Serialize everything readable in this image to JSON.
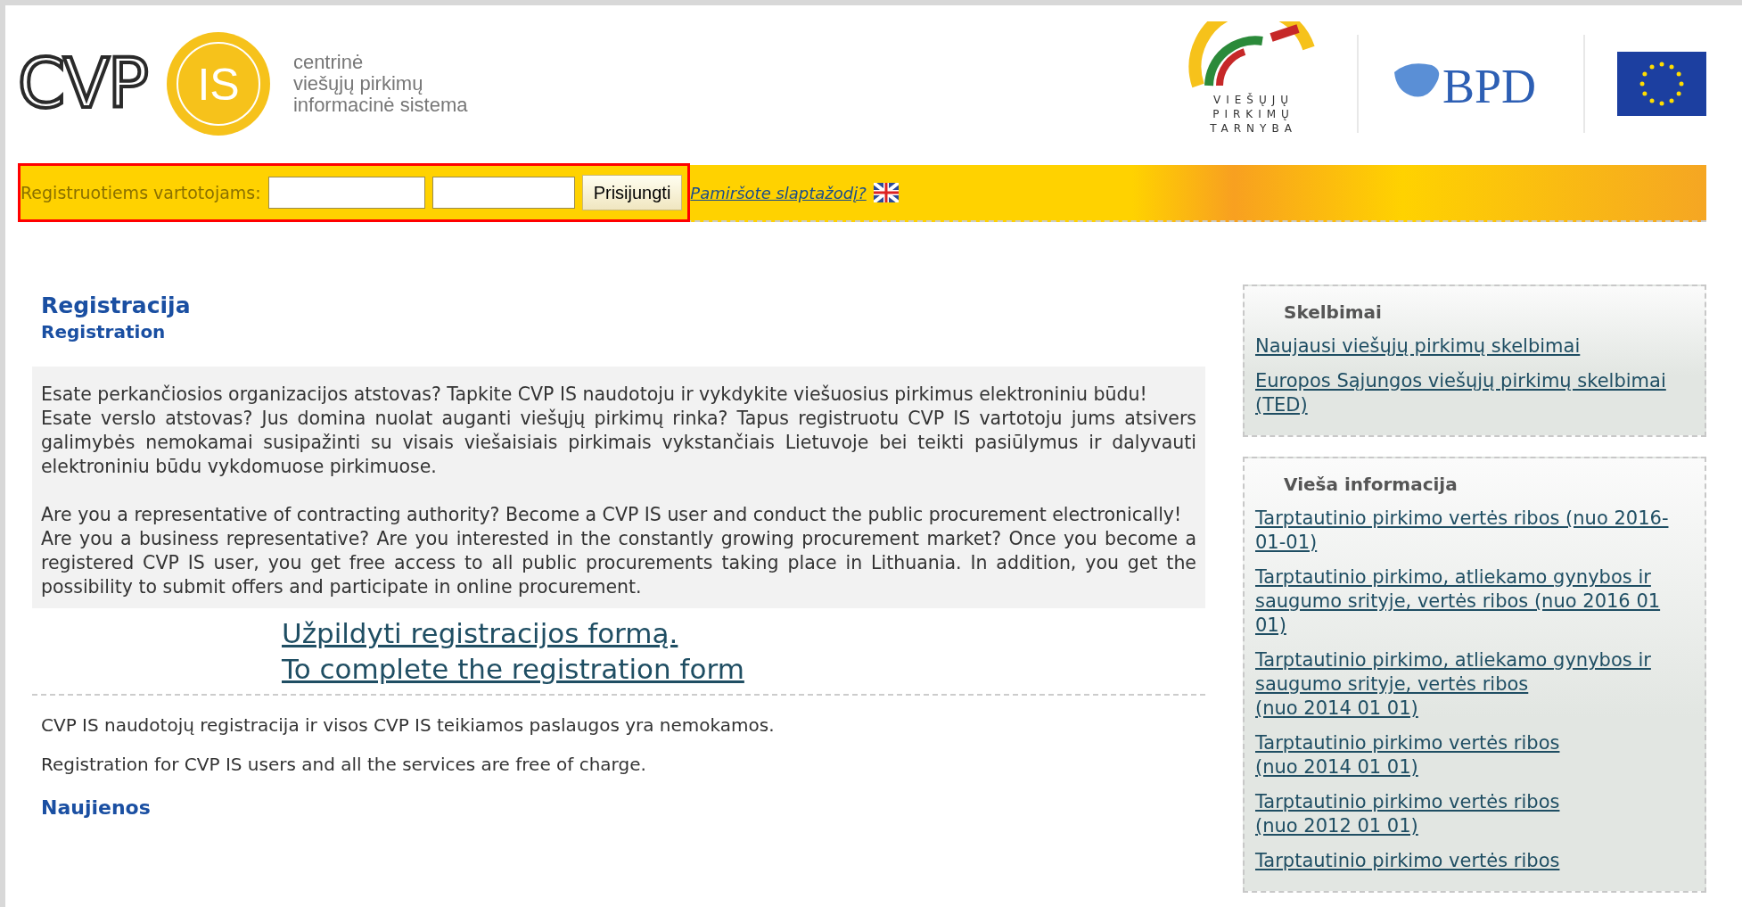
{
  "header": {
    "logo_letters": "CVP",
    "logo_badge": "IS",
    "tagline": [
      "centrinė",
      "viešųjų pirkimų",
      "informacinė sistema"
    ],
    "partner_logos": [
      {
        "kind": "vpt",
        "lines": [
          "VIEŠŲJŲ",
          "PIRKIMŲ",
          "TARNYBA"
        ]
      },
      {
        "kind": "bpd",
        "text": "BPD"
      },
      {
        "kind": "eu"
      }
    ]
  },
  "login": {
    "highlighted": true,
    "label": "Registruotiems vartotojams:",
    "fields": [
      {
        "kind": "text"
      },
      {
        "kind": "password"
      }
    ],
    "button": "Prisijungti",
    "forgot_link": "Pamiršote slaptažodį?"
  },
  "main": {
    "title": "Registracija",
    "subtitle": "Registration",
    "intro": [
      {
        "paragraphs": [
          "Esate perkančiosios organizacijos atstovas? Tapkite CVP IS naudotoju ir vykdykite viešuosius pirkimus elektroniniu būdu!",
          "Esate verslo atstovas? Jus domina nuolat auganti viešųjų pirkimų rinka? Tapus registruotu CVP IS vartotoju jums atsivers galimybės nemokamai susipažinti su visais viešaisiais pirkimais vykstančiais Lietuvoje bei teikti pasiūlymus ir dalyvauti elektroniniu būdu vykdomuose pirkimuose."
        ]
      },
      {
        "paragraphs": [
          "Are you a representative of contracting authority? Become a CVP IS user and conduct the public procurement electronically!",
          "Are you a business representative? Are you interested in the constantly growing procurement market? Once you become a registered CVP IS user, you get free access to all public procurements taking place in Lithuania. In addition, you get the possibility to submit offers and participate in online procurement."
        ]
      }
    ],
    "register_links": [
      "Užpildyti registracijos formą.",
      "To complete the registration form"
    ],
    "notes": [
      "CVP IS naudotojų registracija ir visos CVP IS teikiamos paslaugos yra nemokamos.",
      "Registration for CVP IS users and all the services are free of charge."
    ],
    "news_title": "Naujienos"
  },
  "sidebar": [
    {
      "title": "Skelbimai",
      "links": [
        "Naujausi viešųjų pirkimų skelbimai",
        "Europos Sąjungos viešųjų pirkimų skelbimai (TED)"
      ]
    },
    {
      "title": "Vieša informacija",
      "links": [
        "Tarptautinio pirkimo vertės ribos (nuo 2016-01-01)",
        "Tarptautinio pirkimo, atliekamo gynybos ir saugumo srityje, vertės ribos (nuo 2016 01 01)",
        "Tarptautinio pirkimo, atliekamo gynybos ir saugumo srityje, vertės ribos\n(nuo 2014 01 01)",
        "Tarptautinio pirkimo vertės ribos\n(nuo 2014 01 01)",
        "Tarptautinio pirkimo vertės ribos\n(nuo 2012 01 01)",
        "Tarptautinio pirkimo vertės ribos"
      ]
    }
  ]
}
